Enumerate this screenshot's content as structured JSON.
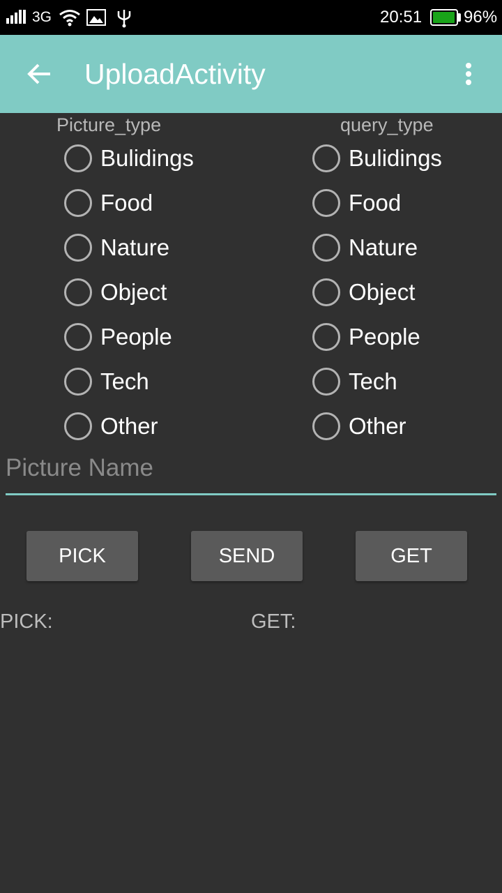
{
  "status_bar": {
    "network": "3G",
    "time": "20:51",
    "battery_percent": "96%",
    "battery_level": 0.96,
    "battery_color": "#19a319"
  },
  "app_bar": {
    "title": "UploadActivity",
    "color": "#80cbc4",
    "back_icon": "arrow-back-icon",
    "overflow_icon": "more-vert-icon"
  },
  "picture_type": {
    "label": "Picture_type",
    "options": [
      "Bulidings",
      "Food",
      "Nature",
      "Object",
      "People",
      "Tech",
      "Other"
    ]
  },
  "query_type": {
    "label": "query_type",
    "options": [
      "Bulidings",
      "Food",
      "Nature",
      "Object",
      "People",
      "Tech",
      "Other"
    ]
  },
  "picture_name": {
    "placeholder": "Picture Name",
    "value": ""
  },
  "buttons": {
    "pick": "PICK",
    "send": "SEND",
    "get": "GET"
  },
  "results": {
    "pick_label": "PICK:",
    "get_label": "GET:"
  }
}
